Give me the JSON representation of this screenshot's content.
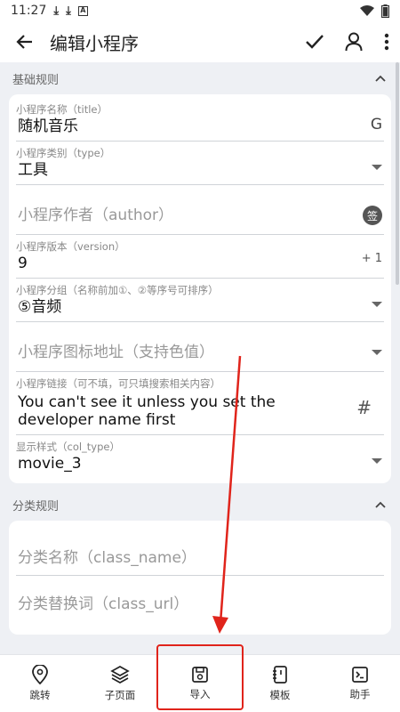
{
  "status": {
    "time": "11:27"
  },
  "header": {
    "title": "编辑小程序"
  },
  "sections": {
    "basic": {
      "title": "基础规则"
    },
    "category": {
      "title": "分类规则"
    }
  },
  "fields": {
    "title": {
      "label": "小程序名称（title）",
      "value": "随机音乐",
      "action": "G"
    },
    "type": {
      "label": "小程序类别（type）",
      "value": "工具"
    },
    "author": {
      "placeholder": "小程序作者（author）",
      "action": "签"
    },
    "version": {
      "label": "小程序版本（version）",
      "value": "9",
      "action": "+ 1"
    },
    "group": {
      "label": "小程序分组（名称前加①、②等序号可排序）",
      "value": "⑤音频"
    },
    "icon": {
      "placeholder": "小程序图标地址（支持色值）"
    },
    "link": {
      "label": "小程序链接（可不填，可只填搜索相关内容）",
      "value": "You can't see it unless you set the developer name first",
      "action": "#"
    },
    "col_type": {
      "label": "显示样式（col_type）",
      "value": "movie_3"
    },
    "class_name": {
      "placeholder": "分类名称（class_name）"
    },
    "class_url": {
      "placeholder": "分类替换词（class_url）"
    }
  },
  "bottom_nav": [
    {
      "label": "跳转",
      "icon": "location-pin-icon"
    },
    {
      "label": "子页面",
      "icon": "layers-icon"
    },
    {
      "label": "导入",
      "icon": "save-icon"
    },
    {
      "label": "模板",
      "icon": "template-icon"
    },
    {
      "label": "助手",
      "icon": "terminal-icon"
    }
  ],
  "colors": {
    "annotation": "#e0241b",
    "background": "#eef0f4",
    "card": "#ffffff"
  }
}
